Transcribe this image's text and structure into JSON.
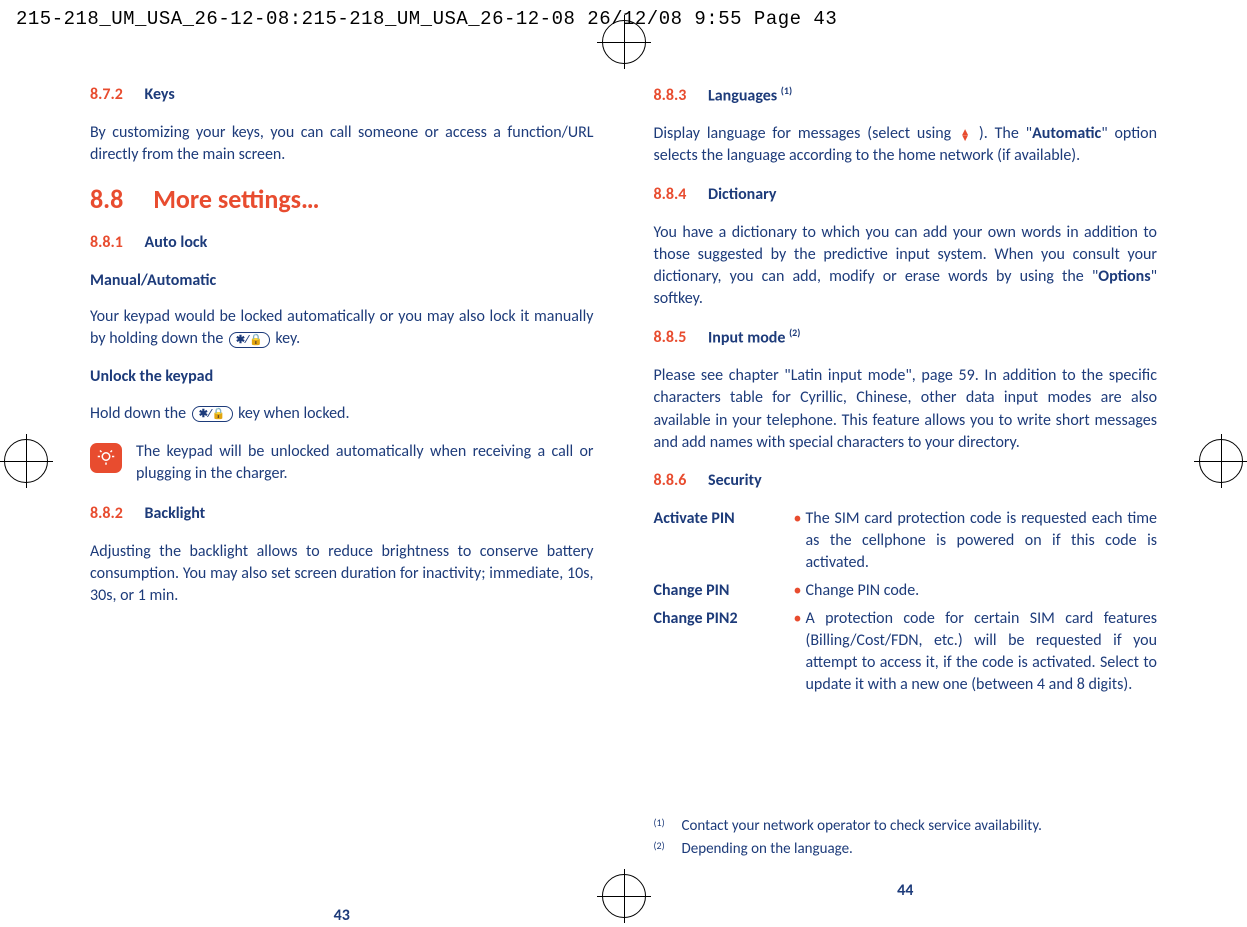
{
  "print_header": "215-218_UM_USA_26-12-08:215-218_UM_USA_26-12-08  26/12/08  9:55  Page 43",
  "left": {
    "h872": {
      "num": "8.7.2",
      "title": "Keys"
    },
    "p872": "By customizing your keys, you can call someone or access a function/URL directly from the main screen.",
    "h88": {
      "num": "8.8",
      "title": "More settings…"
    },
    "h881": {
      "num": "8.8.1",
      "title": "Auto lock"
    },
    "manual_auto": "Manual/Automatic",
    "p881a_before": "Your keypad would be locked automatically or you may also lock it manually by holding down the ",
    "p881a_after": " key.",
    "unlock_h": "Unlock the keypad",
    "unlock_before": "Hold down the ",
    "unlock_after": " key when locked.",
    "tip": "The keypad will be unlocked automatically when receiving a call or plugging in the charger.",
    "h882": {
      "num": "8.8.2",
      "title": "Backlight"
    },
    "p882": "Adjusting the backlight allows to reduce brightness to conserve battery consumption. You may also set screen duration for inactivity; immediate, 10s, 30s, or 1 min.",
    "page_num": "43"
  },
  "right": {
    "h883": {
      "num": "8.8.3",
      "title": "Languages ",
      "sup": "(1)"
    },
    "p883_a": "Display language for messages (select using ",
    "p883_b": "). The \"",
    "p883_bold": "Automatic",
    "p883_c": "\" option selects the language according to the home network (if available).",
    "h884": {
      "num": "8.8.4",
      "title": "Dictionary"
    },
    "p884_a": "You have a dictionary to which you can add your own words in addition to those suggested by the predictive input system. When you consult your dictionary, you can add, modify or erase words by using the \"",
    "p884_bold": "Options",
    "p884_b": "\" softkey.",
    "h885": {
      "num": "8.8.5",
      "title": "Input mode ",
      "sup": "(2)"
    },
    "p885": "Please see chapter \"Latin input mode\", page 59. In addition to the specific characters table for Cyrillic, Chinese, other data input modes are also available in your telephone. This feature allows you to write short messages and add names with special characters to your directory.",
    "h886": {
      "num": "8.8.6",
      "title": "Security"
    },
    "sec": [
      {
        "label": "Activate PIN",
        "desc": "The SIM card protection code is requested each time as the cellphone is powered on if this code is activated."
      },
      {
        "label": "Change PIN",
        "desc": "Change PIN code."
      },
      {
        "label": "Change PIN2",
        "desc": "A protection code for certain SIM card features (Billing/Cost/FDN, etc.) will be requested if you attempt to access it, if the code is activated. Select to update it with a new one (between 4 and 8 digits)."
      }
    ],
    "footnotes": [
      {
        "num": "(1)",
        "text": "Contact your network operator to check service availability."
      },
      {
        "num": "(2)",
        "text": "Depending on the language."
      }
    ],
    "page_num": "44"
  }
}
